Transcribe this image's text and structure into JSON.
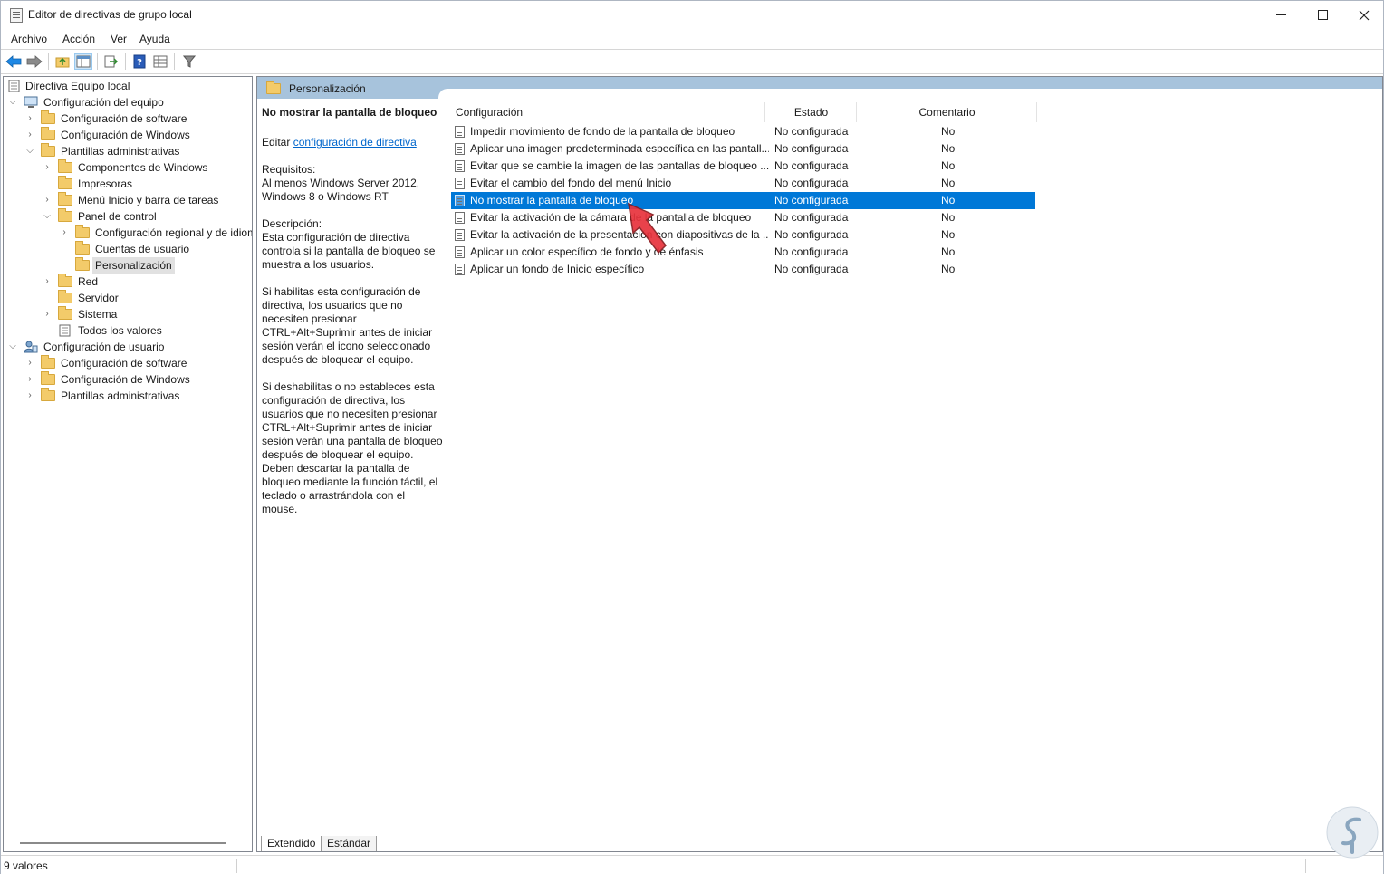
{
  "window": {
    "title": "Editor de directivas de grupo local"
  },
  "menu": {
    "items": [
      "Archivo",
      "Acción",
      "Ver",
      "Ayuda"
    ]
  },
  "tree": {
    "root": "Directiva Equipo local",
    "nodes": [
      "Configuración del equipo",
      "Configuración de software",
      "Configuración de Windows",
      "Plantillas administrativas",
      "Componentes de Windows",
      "Impresoras",
      "Menú Inicio y barra de tareas",
      "Panel de control",
      "Configuración regional y de idioma",
      "Cuentas de usuario",
      "Personalización",
      "Red",
      "Servidor",
      "Sistema",
      "Todos los valores",
      "Configuración de usuario",
      "Configuración de software",
      "Configuración de Windows",
      "Plantillas administrativas"
    ]
  },
  "pane": {
    "header": "Personalización"
  },
  "description": {
    "title": "No mostrar la pantalla de bloqueo",
    "edit_prefix": "Editar",
    "edit_link": "configuración de directiva",
    "requirements_label": "Requisitos:",
    "requirements": "Al menos Windows Server 2012, Windows 8 o Windows RT",
    "description_label": "Descripción:",
    "description": "Esta configuración de directiva controla si la pantalla de bloqueo se muestra a los usuarios.",
    "para1": "Si habilitas esta configuración de directiva, los usuarios que no necesiten presionar CTRL+Alt+Suprimir antes de iniciar sesión verán el icono seleccionado después de bloquear el equipo.",
    "para2": "Si deshabilitas o no estableces esta configuración de directiva, los usuarios que no necesiten presionar CTRL+Alt+Suprimir antes de iniciar sesión verán una pantalla de bloqueo después de bloquear el equipo. Deben descartar la pantalla de bloqueo mediante la función táctil, el teclado o arrastrándola con el mouse."
  },
  "list": {
    "columns": {
      "config": "Configuración",
      "state": "Estado",
      "comment": "Comentario"
    },
    "rows": [
      {
        "name": "Impedir movimiento de fondo de la pantalla de bloqueo",
        "state": "No configurada",
        "comment": "No"
      },
      {
        "name": "Aplicar una imagen predeterminada específica en las pantall...",
        "state": "No configurada",
        "comment": "No"
      },
      {
        "name": "Evitar que se cambie la imagen de las pantallas de bloqueo ...",
        "state": "No configurada",
        "comment": "No"
      },
      {
        "name": "Evitar el cambio del fondo del menú Inicio",
        "state": "No configurada",
        "comment": "No"
      },
      {
        "name": "No mostrar la pantalla de bloqueo",
        "state": "No configurada",
        "comment": "No"
      },
      {
        "name": "Evitar la activación de la cámara de la pantalla de bloqueo",
        "state": "No configurada",
        "comment": "No"
      },
      {
        "name": "Evitar la activación de la presentación con diapositivas de la ...",
        "state": "No configurada",
        "comment": "No"
      },
      {
        "name": "Aplicar un color específico de fondo y de énfasis",
        "state": "No configurada",
        "comment": "No"
      },
      {
        "name": "Aplicar un fondo de Inicio específico",
        "state": "No configurada",
        "comment": "No"
      }
    ]
  },
  "tabs": {
    "extended": "Extendido",
    "standard": "Estándar"
  },
  "status": {
    "text": "9 valores"
  },
  "colors": {
    "selection": "#0078d7",
    "header": "#a7c3dc",
    "link": "#0066cc",
    "cursor": "#e8323c"
  }
}
